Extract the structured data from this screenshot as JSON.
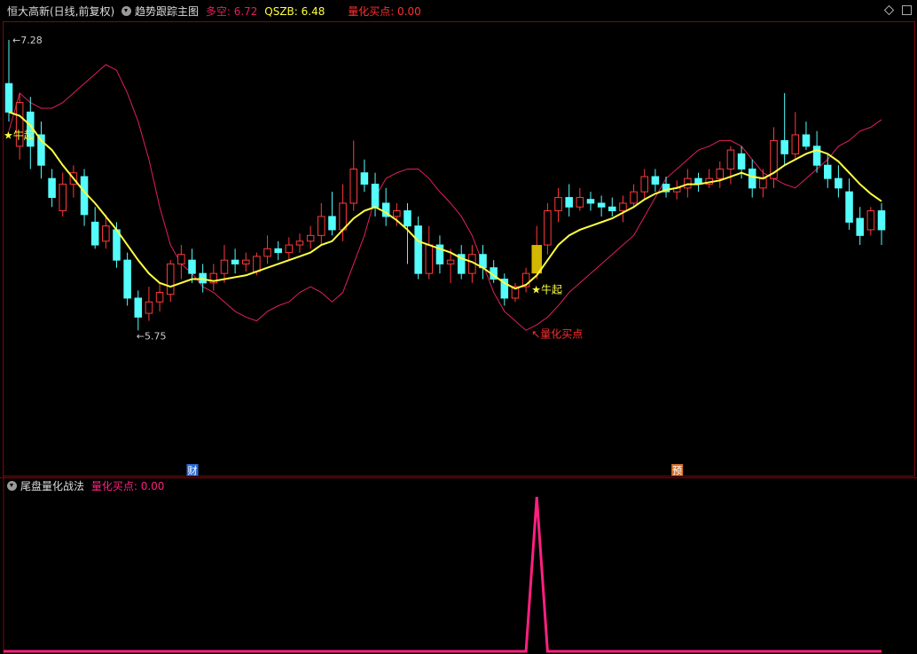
{
  "header": {
    "stock_title": "恒大高新(日线,前复权)",
    "indicator_name": "趋势跟踪主图",
    "duokong_label": "多空: ",
    "duokong_value": "6.72",
    "qszb_label": "QSZB: ",
    "qszb_value": "6.48",
    "buy_label": "量化买点: ",
    "buy_value": "0.00"
  },
  "sub_header": {
    "indicator_name": "尾盘量化战法",
    "buy_label": "量化买点: ",
    "buy_value": "0.00"
  },
  "chart_data": [
    {
      "type": "candlestick",
      "ylim": [
        5.2,
        7.35
      ],
      "y_high_label": "7.28",
      "y_low_label": "5.75",
      "colors": {
        "up": "#ff3a3a",
        "down": "#54fcfc",
        "qszb": "#ffff40",
        "duokong": "#e0205a",
        "signal_bar": "#d4b800"
      },
      "candles": [
        [
          7.05,
          6.9,
          7.28,
          6.85
        ],
        [
          6.72,
          6.95,
          7.0,
          6.65
        ],
        [
          6.9,
          6.72,
          6.98,
          6.6
        ],
        [
          6.78,
          6.62,
          6.85,
          6.55
        ],
        [
          6.55,
          6.45,
          6.6,
          6.4
        ],
        [
          6.38,
          6.52,
          6.58,
          6.35
        ],
        [
          6.52,
          6.58,
          6.62,
          6.45
        ],
        [
          6.56,
          6.36,
          6.6,
          6.3
        ],
        [
          6.32,
          6.2,
          6.4,
          6.18
        ],
        [
          6.22,
          6.3,
          6.36,
          6.18
        ],
        [
          6.28,
          6.12,
          6.32,
          6.08
        ],
        [
          6.12,
          5.92,
          6.16,
          5.88
        ],
        [
          5.92,
          5.82,
          5.96,
          5.75
        ],
        [
          5.84,
          5.9,
          5.98,
          5.8
        ],
        [
          5.9,
          5.95,
          6.0,
          5.85
        ],
        [
          5.94,
          6.1,
          6.12,
          5.9
        ],
        [
          6.1,
          6.15,
          6.2,
          6.02
        ],
        [
          6.12,
          6.05,
          6.18,
          6.0
        ],
        [
          6.05,
          6.0,
          6.1,
          5.95
        ],
        [
          6.0,
          6.05,
          6.1,
          5.96
        ],
        [
          6.05,
          6.12,
          6.2,
          6.0
        ],
        [
          6.12,
          6.1,
          6.18,
          6.05
        ],
        [
          6.1,
          6.12,
          6.16,
          6.06
        ],
        [
          6.06,
          6.14,
          6.16,
          6.04
        ],
        [
          6.14,
          6.18,
          6.25,
          6.1
        ],
        [
          6.18,
          6.16,
          6.22,
          6.12
        ],
        [
          6.16,
          6.2,
          6.24,
          6.12
        ],
        [
          6.2,
          6.22,
          6.26,
          6.16
        ],
        [
          6.22,
          6.25,
          6.3,
          6.18
        ],
        [
          6.25,
          6.35,
          6.42,
          6.2
        ],
        [
          6.35,
          6.28,
          6.48,
          6.25
        ],
        [
          6.28,
          6.42,
          6.52,
          6.22
        ],
        [
          6.42,
          6.6,
          6.75,
          6.38
        ],
        [
          6.58,
          6.52,
          6.65,
          6.48
        ],
        [
          6.52,
          6.4,
          6.58,
          6.35
        ],
        [
          6.42,
          6.35,
          6.5,
          6.3
        ],
        [
          6.35,
          6.38,
          6.42,
          6.3
        ],
        [
          6.38,
          6.3,
          6.42,
          6.1
        ],
        [
          6.3,
          6.05,
          6.35,
          6.02
        ],
        [
          6.05,
          6.2,
          6.3,
          6.02
        ],
        [
          6.2,
          6.1,
          6.25,
          6.05
        ],
        [
          6.1,
          6.12,
          6.18,
          6.0
        ],
        [
          6.15,
          6.05,
          6.2,
          6.02
        ],
        [
          6.05,
          6.15,
          6.2,
          6.0
        ],
        [
          6.15,
          6.08,
          6.2,
          6.02
        ],
        [
          6.08,
          6.02,
          6.12,
          6.0
        ],
        [
          6.02,
          5.92,
          6.05,
          5.88
        ],
        [
          5.92,
          5.98,
          6.0,
          5.9
        ],
        [
          5.98,
          6.05,
          6.08,
          5.95
        ],
        [
          6.05,
          6.2,
          6.3,
          6.02
        ],
        [
          6.2,
          6.38,
          6.42,
          6.15
        ],
        [
          6.38,
          6.45,
          6.5,
          6.32
        ],
        [
          6.45,
          6.4,
          6.52,
          6.35
        ],
        [
          6.4,
          6.45,
          6.5,
          6.38
        ],
        [
          6.44,
          6.42,
          6.48,
          6.38
        ],
        [
          6.42,
          6.4,
          6.46,
          6.35
        ],
        [
          6.4,
          6.38,
          6.45,
          6.35
        ],
        [
          6.38,
          6.42,
          6.46,
          6.32
        ],
        [
          6.42,
          6.48,
          6.52,
          6.4
        ],
        [
          6.48,
          6.56,
          6.6,
          6.44
        ],
        [
          6.56,
          6.52,
          6.6,
          6.48
        ],
        [
          6.52,
          6.48,
          6.56,
          6.45
        ],
        [
          6.48,
          6.5,
          6.54,
          6.44
        ],
        [
          6.5,
          6.55,
          6.6,
          6.45
        ],
        [
          6.55,
          6.52,
          6.58,
          6.48
        ],
        [
          6.52,
          6.55,
          6.6,
          6.5
        ],
        [
          6.55,
          6.6,
          6.64,
          6.5
        ],
        [
          6.6,
          6.7,
          6.72,
          6.52
        ],
        [
          6.68,
          6.6,
          6.72,
          6.55
        ],
        [
          6.6,
          6.5,
          6.65,
          6.45
        ],
        [
          6.5,
          6.55,
          6.6,
          6.45
        ],
        [
          6.55,
          6.75,
          6.82,
          6.5
        ],
        [
          6.75,
          6.68,
          7.0,
          6.62
        ],
        [
          6.68,
          6.78,
          6.9,
          6.65
        ],
        [
          6.78,
          6.72,
          6.85,
          6.7
        ],
        [
          6.72,
          6.62,
          6.8,
          6.58
        ],
        [
          6.62,
          6.55,
          6.68,
          6.5
        ],
        [
          6.55,
          6.5,
          6.62,
          6.45
        ],
        [
          6.48,
          6.32,
          6.55,
          6.28
        ],
        [
          6.34,
          6.25,
          6.4,
          6.2
        ],
        [
          6.28,
          6.38,
          6.4,
          6.25
        ],
        [
          6.38,
          6.28,
          6.42,
          6.2
        ]
      ],
      "qszb": [
        6.9,
        6.88,
        6.83,
        6.75,
        6.7,
        6.62,
        6.55,
        6.48,
        6.42,
        6.35,
        6.28,
        6.2,
        6.12,
        6.05,
        6.0,
        5.98,
        6.0,
        6.02,
        6.02,
        6.01,
        6.02,
        6.03,
        6.04,
        6.06,
        6.08,
        6.1,
        6.12,
        6.14,
        6.16,
        6.2,
        6.22,
        6.28,
        6.34,
        6.38,
        6.4,
        6.37,
        6.33,
        6.28,
        6.22,
        6.2,
        6.18,
        6.16,
        6.13,
        6.11,
        6.08,
        6.04,
        6.0,
        5.97,
        5.99,
        6.04,
        6.12,
        6.2,
        6.25,
        6.28,
        6.3,
        6.32,
        6.34,
        6.37,
        6.4,
        6.44,
        6.47,
        6.49,
        6.5,
        6.52,
        6.52,
        6.53,
        6.54,
        6.56,
        6.58,
        6.56,
        6.55,
        6.58,
        6.62,
        6.65,
        6.68,
        6.7,
        6.68,
        6.64,
        6.58,
        6.52,
        6.47,
        6.43
      ],
      "duokong": [
        6.8,
        7.0,
        6.95,
        6.92,
        6.92,
        6.95,
        7.0,
        7.05,
        7.1,
        7.15,
        7.12,
        7.0,
        6.85,
        6.65,
        6.4,
        6.2,
        6.1,
        6.05,
        5.98,
        5.95,
        5.9,
        5.85,
        5.82,
        5.8,
        5.85,
        5.88,
        5.9,
        5.95,
        5.98,
        5.95,
        5.9,
        5.95,
        6.1,
        6.25,
        6.45,
        6.55,
        6.58,
        6.6,
        6.6,
        6.55,
        6.48,
        6.42,
        6.35,
        6.25,
        6.1,
        5.95,
        5.85,
        5.8,
        5.75,
        5.78,
        5.82,
        5.88,
        5.95,
        6.0,
        6.05,
        6.1,
        6.15,
        6.2,
        6.25,
        6.35,
        6.45,
        6.55,
        6.6,
        6.65,
        6.7,
        6.72,
        6.75,
        6.75,
        6.72,
        6.65,
        6.58,
        6.55,
        6.52,
        6.5,
        6.55,
        6.6,
        6.65,
        6.72,
        6.75,
        6.8,
        6.82,
        6.86
      ],
      "annotations": [
        {
          "text": "★牛起",
          "candle": 0,
          "color": "#ffff40"
        },
        {
          "text": "★牛起",
          "candle": 49,
          "color": "#ffff40"
        },
        {
          "text": "↖量化买点",
          "candle": 49,
          "color": "#ff3030"
        }
      ],
      "event_badges": [
        {
          "text": "财",
          "candle": 17,
          "bg": "#2a6cd6",
          "color": "#fff"
        },
        {
          "text": "预",
          "candle": 62,
          "bg": "#d4702a",
          "color": "#fff"
        }
      ]
    },
    {
      "type": "line",
      "name": "量化买点",
      "color": "#ff2080",
      "signal_index": 49,
      "values_note_zero_elsewhere": true
    }
  ]
}
